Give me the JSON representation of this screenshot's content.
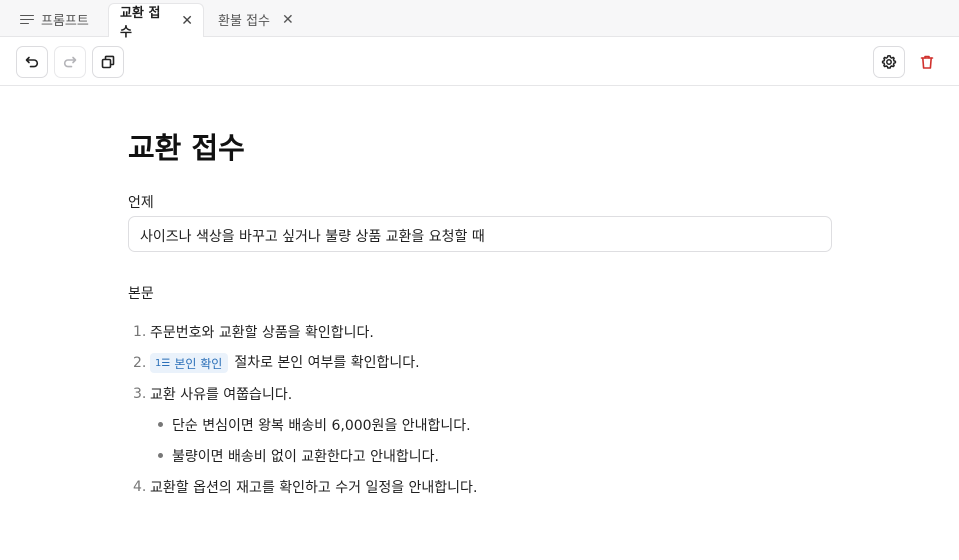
{
  "tabs": [
    {
      "label": "프롬프트",
      "icon": "lines-icon",
      "active": false,
      "closable": false
    },
    {
      "label": "교환 접수",
      "active": true,
      "closable": true
    },
    {
      "label": "환불 접수",
      "active": false,
      "closable": true
    }
  ],
  "tab_close_glyph": "✕",
  "toolbar": {
    "undo_icon": "undo-icon",
    "redo_icon": "redo-icon",
    "duplicate_icon": "duplicate-icon",
    "settings_icon": "gear-icon",
    "delete_icon": "trash-icon"
  },
  "page": {
    "title": "교환 접수",
    "subject_label": "언제",
    "subject_value": "사이즈나 색상을 바꾸고 싶거나 불량 상품 교환을 요청할 때",
    "body_label": "본문",
    "steps": [
      {
        "num": "1.",
        "text": "주문번호와 교환할 상품을 확인합니다."
      },
      {
        "num": "2.",
        "chip": "본인 확인",
        "text": "절차로 본인 여부를 확인합니다."
      },
      {
        "num": "3.",
        "text": "교환 사유를 여쭙습니다."
      },
      {
        "sub": true,
        "text": "단순 변심이면 왕복 배송비 6,000원을 안내합니다."
      },
      {
        "sub": true,
        "text": "불량이면 배송비 없이 교환한다고 안내합니다."
      },
      {
        "num": "4.",
        "text": "교환할 옵션의 재고를 확인하고 수거 일정을 안내합니다."
      }
    ]
  },
  "colors": {
    "accent_chip_bg": "#eaf2fb",
    "accent_chip_text": "#2a6fb8",
    "delete_red": "#d0312d"
  }
}
